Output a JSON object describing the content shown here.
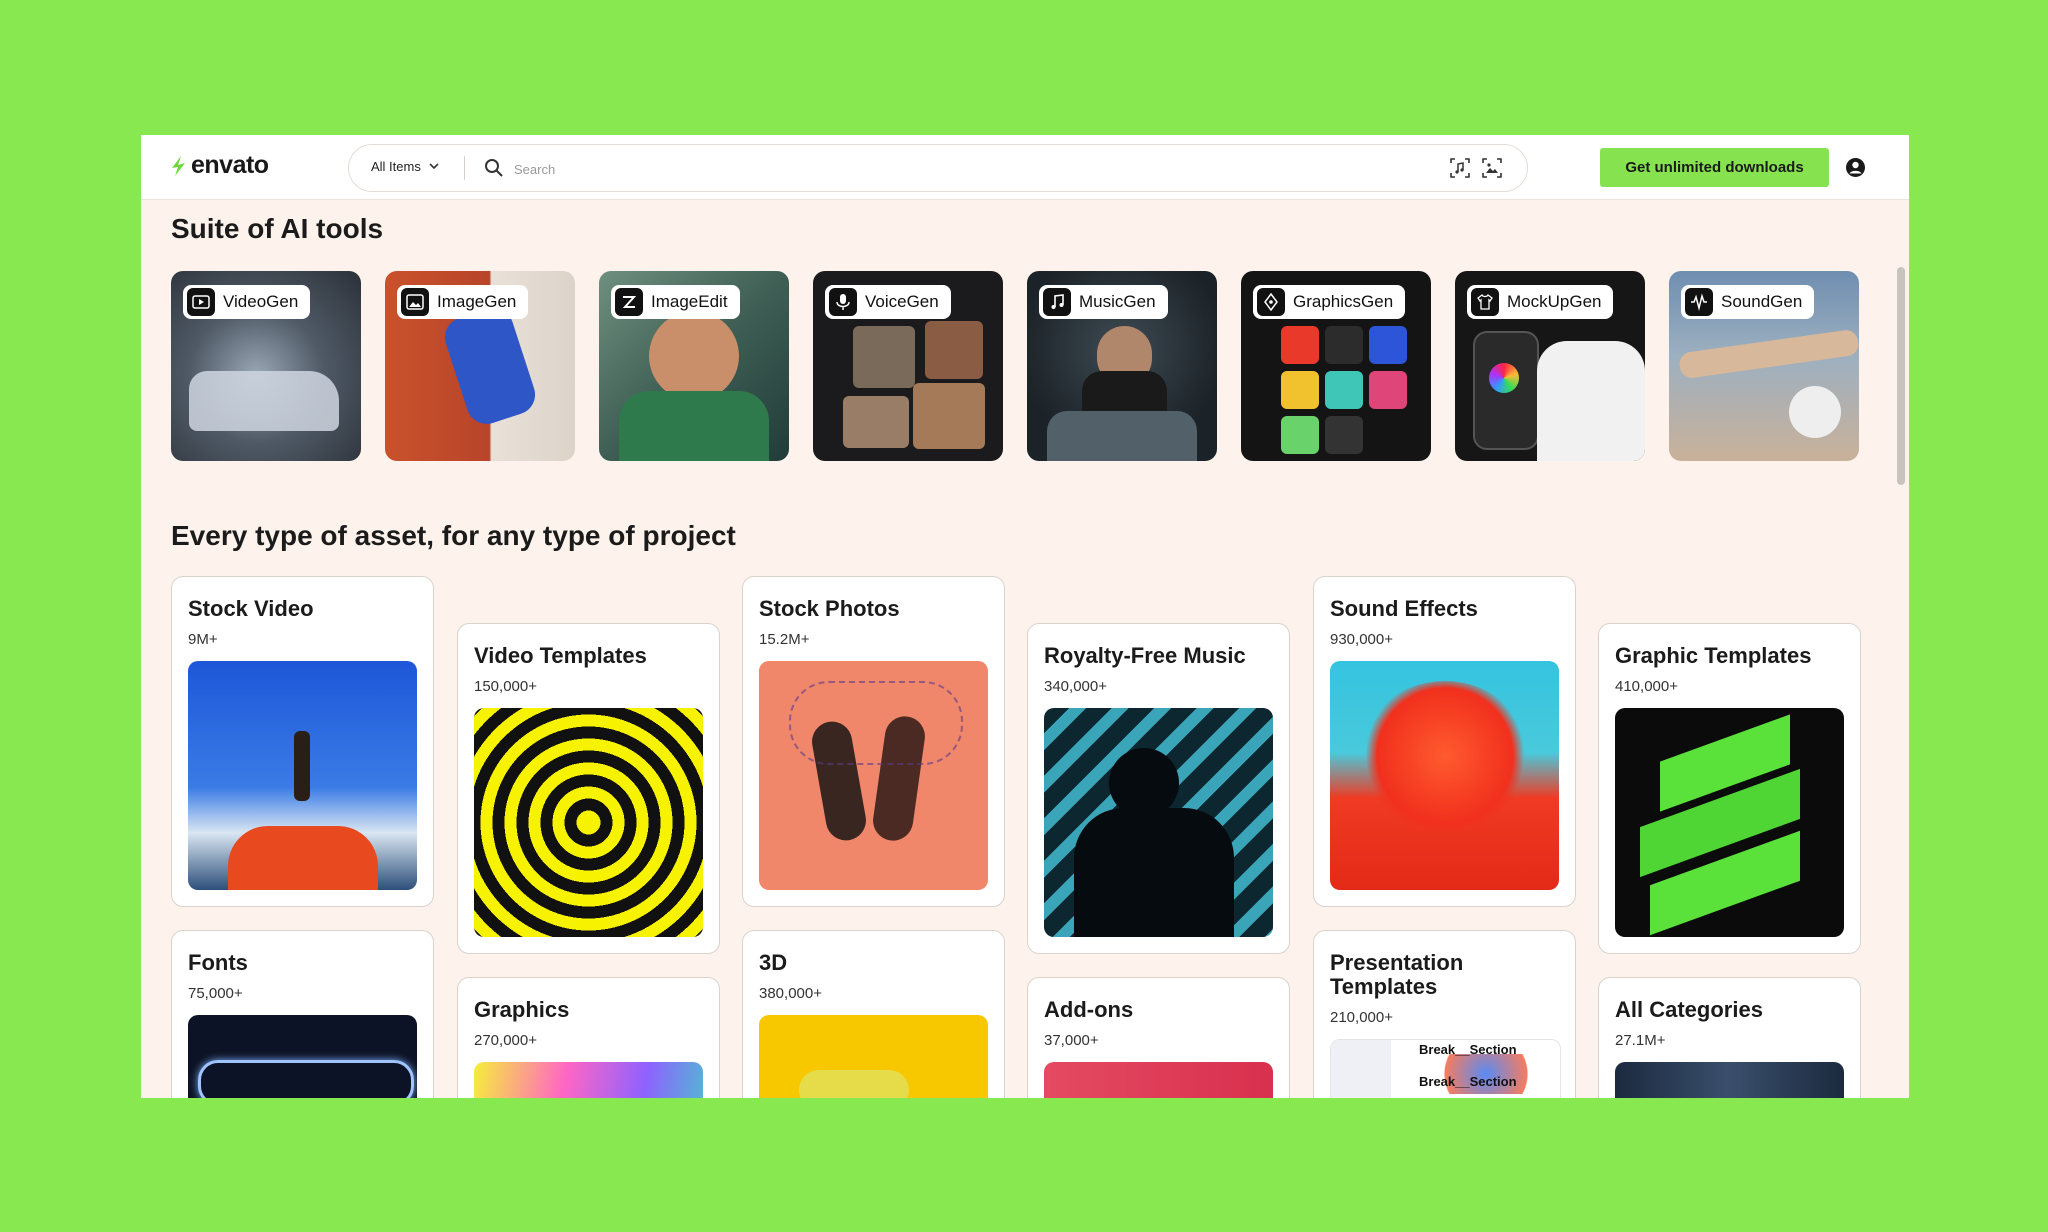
{
  "brand": {
    "name": "envato",
    "accent": "#86e34f"
  },
  "search": {
    "filter_label": "All Items",
    "placeholder": "Search"
  },
  "header": {
    "cta_label": "Get unlimited downloads"
  },
  "ai_section": {
    "title": "Suite of AI tools",
    "tools": [
      {
        "label": "VideoGen",
        "icon": "video-icon"
      },
      {
        "label": "ImageGen",
        "icon": "image-icon"
      },
      {
        "label": "ImageEdit",
        "icon": "edit-icon"
      },
      {
        "label": "VoiceGen",
        "icon": "microphone-icon"
      },
      {
        "label": "MusicGen",
        "icon": "music-note-icon"
      },
      {
        "label": "GraphicsGen",
        "icon": "pen-tool-icon"
      },
      {
        "label": "MockUpGen",
        "icon": "tshirt-icon"
      },
      {
        "label": "SoundGen",
        "icon": "waveform-icon"
      }
    ]
  },
  "assets_section": {
    "title": "Every type of asset, for any type of project",
    "cards": [
      {
        "title": "Stock Video",
        "count": "9M+"
      },
      {
        "title": "Video Templates",
        "count": "150,000+"
      },
      {
        "title": "Stock Photos",
        "count": "15.2M+"
      },
      {
        "title": "Royalty-Free Music",
        "count": "340,000+"
      },
      {
        "title": "Sound Effects",
        "count": "930,000+"
      },
      {
        "title": "Graphic Templates",
        "count": "410,000+"
      },
      {
        "title": "Fonts",
        "count": "75,000+"
      },
      {
        "title": "Graphics",
        "count": "270,000+"
      },
      {
        "title": "3D",
        "count": "380,000+"
      },
      {
        "title": "Add-ons",
        "count": "37,000+"
      },
      {
        "title": "Presentation Templates",
        "count": "210,000+"
      },
      {
        "title": "All Categories",
        "count": "27.1M+"
      }
    ],
    "presentation_thumb_lines": [
      "Break__Section",
      "Break__Section"
    ]
  }
}
